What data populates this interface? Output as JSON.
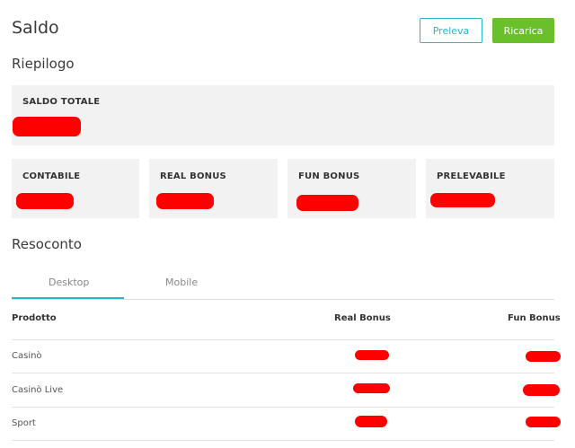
{
  "header": {
    "title": "Saldo",
    "withdraw_label": "Preleva",
    "recharge_label": "Ricarica"
  },
  "summary": {
    "title": "Riepilogo",
    "total_label": "SALDO TOTALE",
    "cards": [
      {
        "label": "CONTABILE"
      },
      {
        "label": "REAL BONUS"
      },
      {
        "label": "FUN BONUS"
      },
      {
        "label": "PRELEVABILE"
      }
    ]
  },
  "report": {
    "title": "Resoconto",
    "tabs": [
      {
        "label": "Desktop"
      },
      {
        "label": "Mobile"
      }
    ],
    "active_tab": "Desktop",
    "columns": [
      "Prodotto",
      "Real Bonus",
      "Fun Bonus"
    ],
    "rows": [
      {
        "product": "Casinò"
      },
      {
        "product": "Casinò Live"
      },
      {
        "product": "Sport"
      }
    ]
  },
  "colors": {
    "accent": "#2ab4c8",
    "primary_button": "#6ac02b",
    "redaction": "#ff0000",
    "card_bg": "#f2f2f2"
  }
}
